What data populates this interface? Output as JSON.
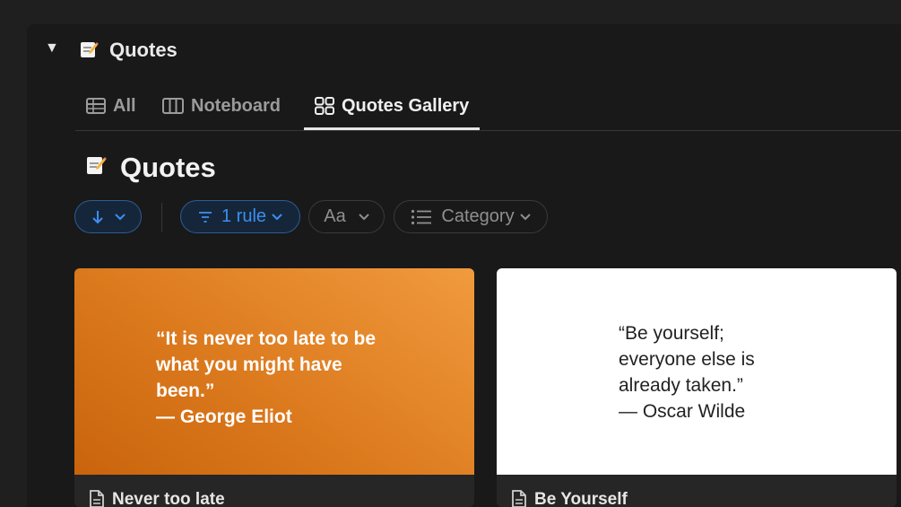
{
  "header": {
    "title": "Quotes",
    "icon": "memo-icon"
  },
  "tabs": [
    {
      "label": "All",
      "icon": "table-icon",
      "active": false
    },
    {
      "label": "Noteboard",
      "icon": "board-icon",
      "active": false
    },
    {
      "label": "Quotes Gallery",
      "icon": "gallery-icon",
      "active": true
    }
  ],
  "page": {
    "title": "Quotes",
    "icon": "memo-icon"
  },
  "toolbar": {
    "sort": {
      "icon": "arrow-down-icon"
    },
    "filter": {
      "label": "1 rule"
    },
    "property": {
      "label": "Aa"
    },
    "group": {
      "label": "Category"
    }
  },
  "cards": [
    {
      "quote": "“It is never too late to be\nwhat you might have\nbeen.”\n— George Eliot",
      "title": "Never too late"
    },
    {
      "quote": "“Be yourself;\neveryone else is\nalready taken.”\n— Oscar Wilde",
      "title": "Be Yourself"
    }
  ],
  "colors": {
    "accent": "#3b8ff0",
    "card_orange": "#dc7a1e",
    "panel_bg": "#191919"
  }
}
